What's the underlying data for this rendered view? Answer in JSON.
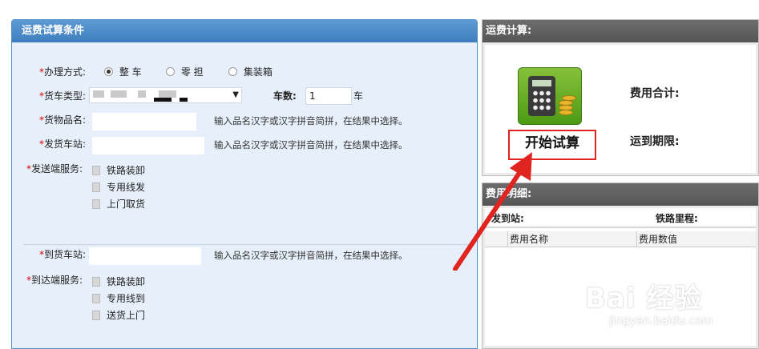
{
  "left": {
    "title": "运费试算条件",
    "handle_mode": {
      "label": "办理方式:",
      "options": [
        "整 车",
        "零 担",
        "集装箱"
      ],
      "selected": 0
    },
    "wagon_type": {
      "label": "货车类型:"
    },
    "car_count": {
      "label": "车数:",
      "value": "1",
      "unit": "车"
    },
    "goods": {
      "label": "货物品名:",
      "hint": "输入品名汉字或汉字拼音简拼，在结果中选择。"
    },
    "from_station": {
      "label": "发货车站:",
      "hint": "输入品名汉字或汉字拼音简拼，在结果中选择。"
    },
    "send_service": {
      "label": "发送端服务:",
      "items": [
        "铁路装卸",
        "专用线发",
        "上门取货"
      ]
    },
    "to_station": {
      "label": "到货车站:",
      "hint": "输入品名汉字或汉字拼音简拼，在结果中选择。"
    },
    "arrive_service": {
      "label": "到达端服务:",
      "items": [
        "铁路装卸",
        "专用线到",
        "送货上门"
      ]
    },
    "required_mark": "*"
  },
  "calc": {
    "title": "运费计算:",
    "start_button": "开始试算",
    "total_label": "费用合计:",
    "deadline_label": "运到期限:"
  },
  "fee": {
    "title": "费用明细:",
    "route_label": "发到站:",
    "mileage_label": "铁路里程:",
    "columns": [
      "费用名称",
      "费用数值"
    ]
  },
  "watermark": {
    "brand": "Bai 经验",
    "url": "jingyan.baidu.com"
  },
  "colors": {
    "left_header": "#4a8ac9",
    "right_header": "#5f5f5f",
    "annotation_red": "#e0241f",
    "required_red": "#d40000"
  }
}
